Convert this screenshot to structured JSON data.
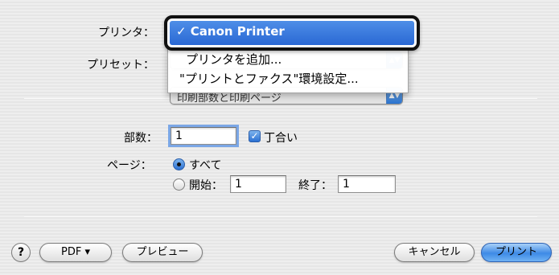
{
  "printer": {
    "label": "プリンタ：",
    "selected": "✓ Canon Printer",
    "menu_items": [
      "プリンタを追加...",
      "\"プリントとファクス\"環境設定..."
    ]
  },
  "preset": {
    "label": "プリセット："
  },
  "panel_popup": {
    "value": "印刷部数と印刷ページ",
    "arrow": "▲▼"
  },
  "copies": {
    "label": "部数：",
    "value": "1",
    "collate_label": "丁合い",
    "collate_checked": true
  },
  "pages": {
    "label": "ページ：",
    "all_label": "すべて",
    "from_label": "開始：",
    "from_value": "1",
    "to_label": "終了：",
    "to_value": "1"
  },
  "footer": {
    "help": "?",
    "pdf": "PDF ▾",
    "preview": "プレビュー",
    "cancel": "キャンセル",
    "print": "プリント"
  },
  "colors": {
    "accent": "#2a68d4",
    "background": "#ececec"
  }
}
